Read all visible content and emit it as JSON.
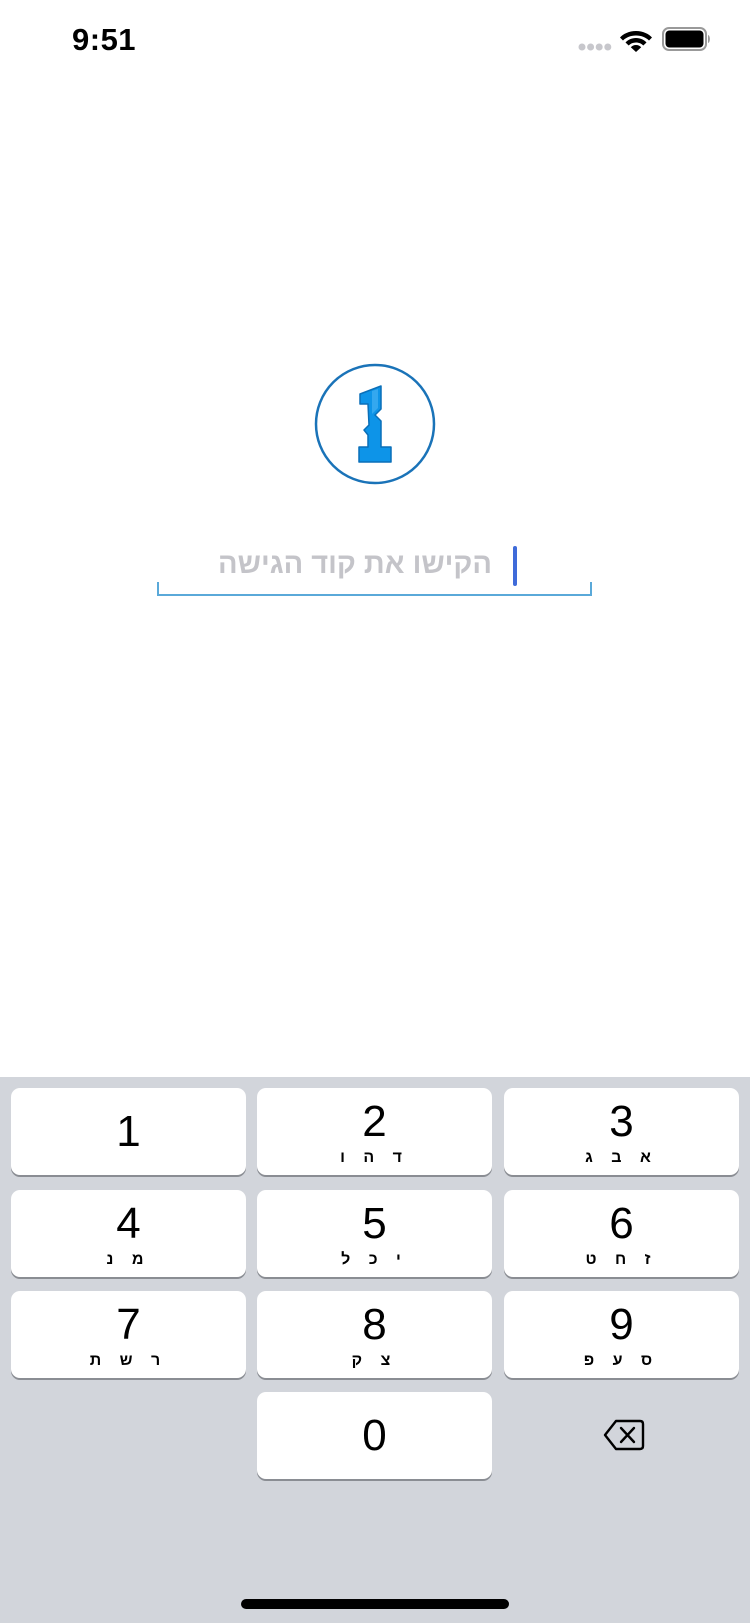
{
  "status_bar": {
    "time": "9:51",
    "icons": [
      "signal-icon",
      "wifi-icon",
      "battery-icon"
    ]
  },
  "logo": {
    "icon": "1password-logo-icon",
    "color": "#0d94e8",
    "ring_color": "#1a73b8"
  },
  "passcode": {
    "placeholder": "הקישו את קוד הגישה",
    "value": ""
  },
  "keypad": {
    "keys": [
      {
        "digit": "1",
        "letters": ""
      },
      {
        "digit": "2",
        "letters": "ד ה ו"
      },
      {
        "digit": "3",
        "letters": "א ב ג"
      },
      {
        "digit": "4",
        "letters": "מ נ"
      },
      {
        "digit": "5",
        "letters": "י כ ל"
      },
      {
        "digit": "6",
        "letters": "ז ח ט"
      },
      {
        "digit": "7",
        "letters": "ר ש ת"
      },
      {
        "digit": "8",
        "letters": "צ ק"
      },
      {
        "digit": "9",
        "letters": "ס ע פ"
      },
      {
        "digit": "0",
        "letters": ""
      }
    ],
    "delete_icon": "backspace-icon"
  },
  "colors": {
    "accent": "#5aa9d9",
    "cursor": "#3f6bd9",
    "keypad_background": "#d2d5db"
  }
}
